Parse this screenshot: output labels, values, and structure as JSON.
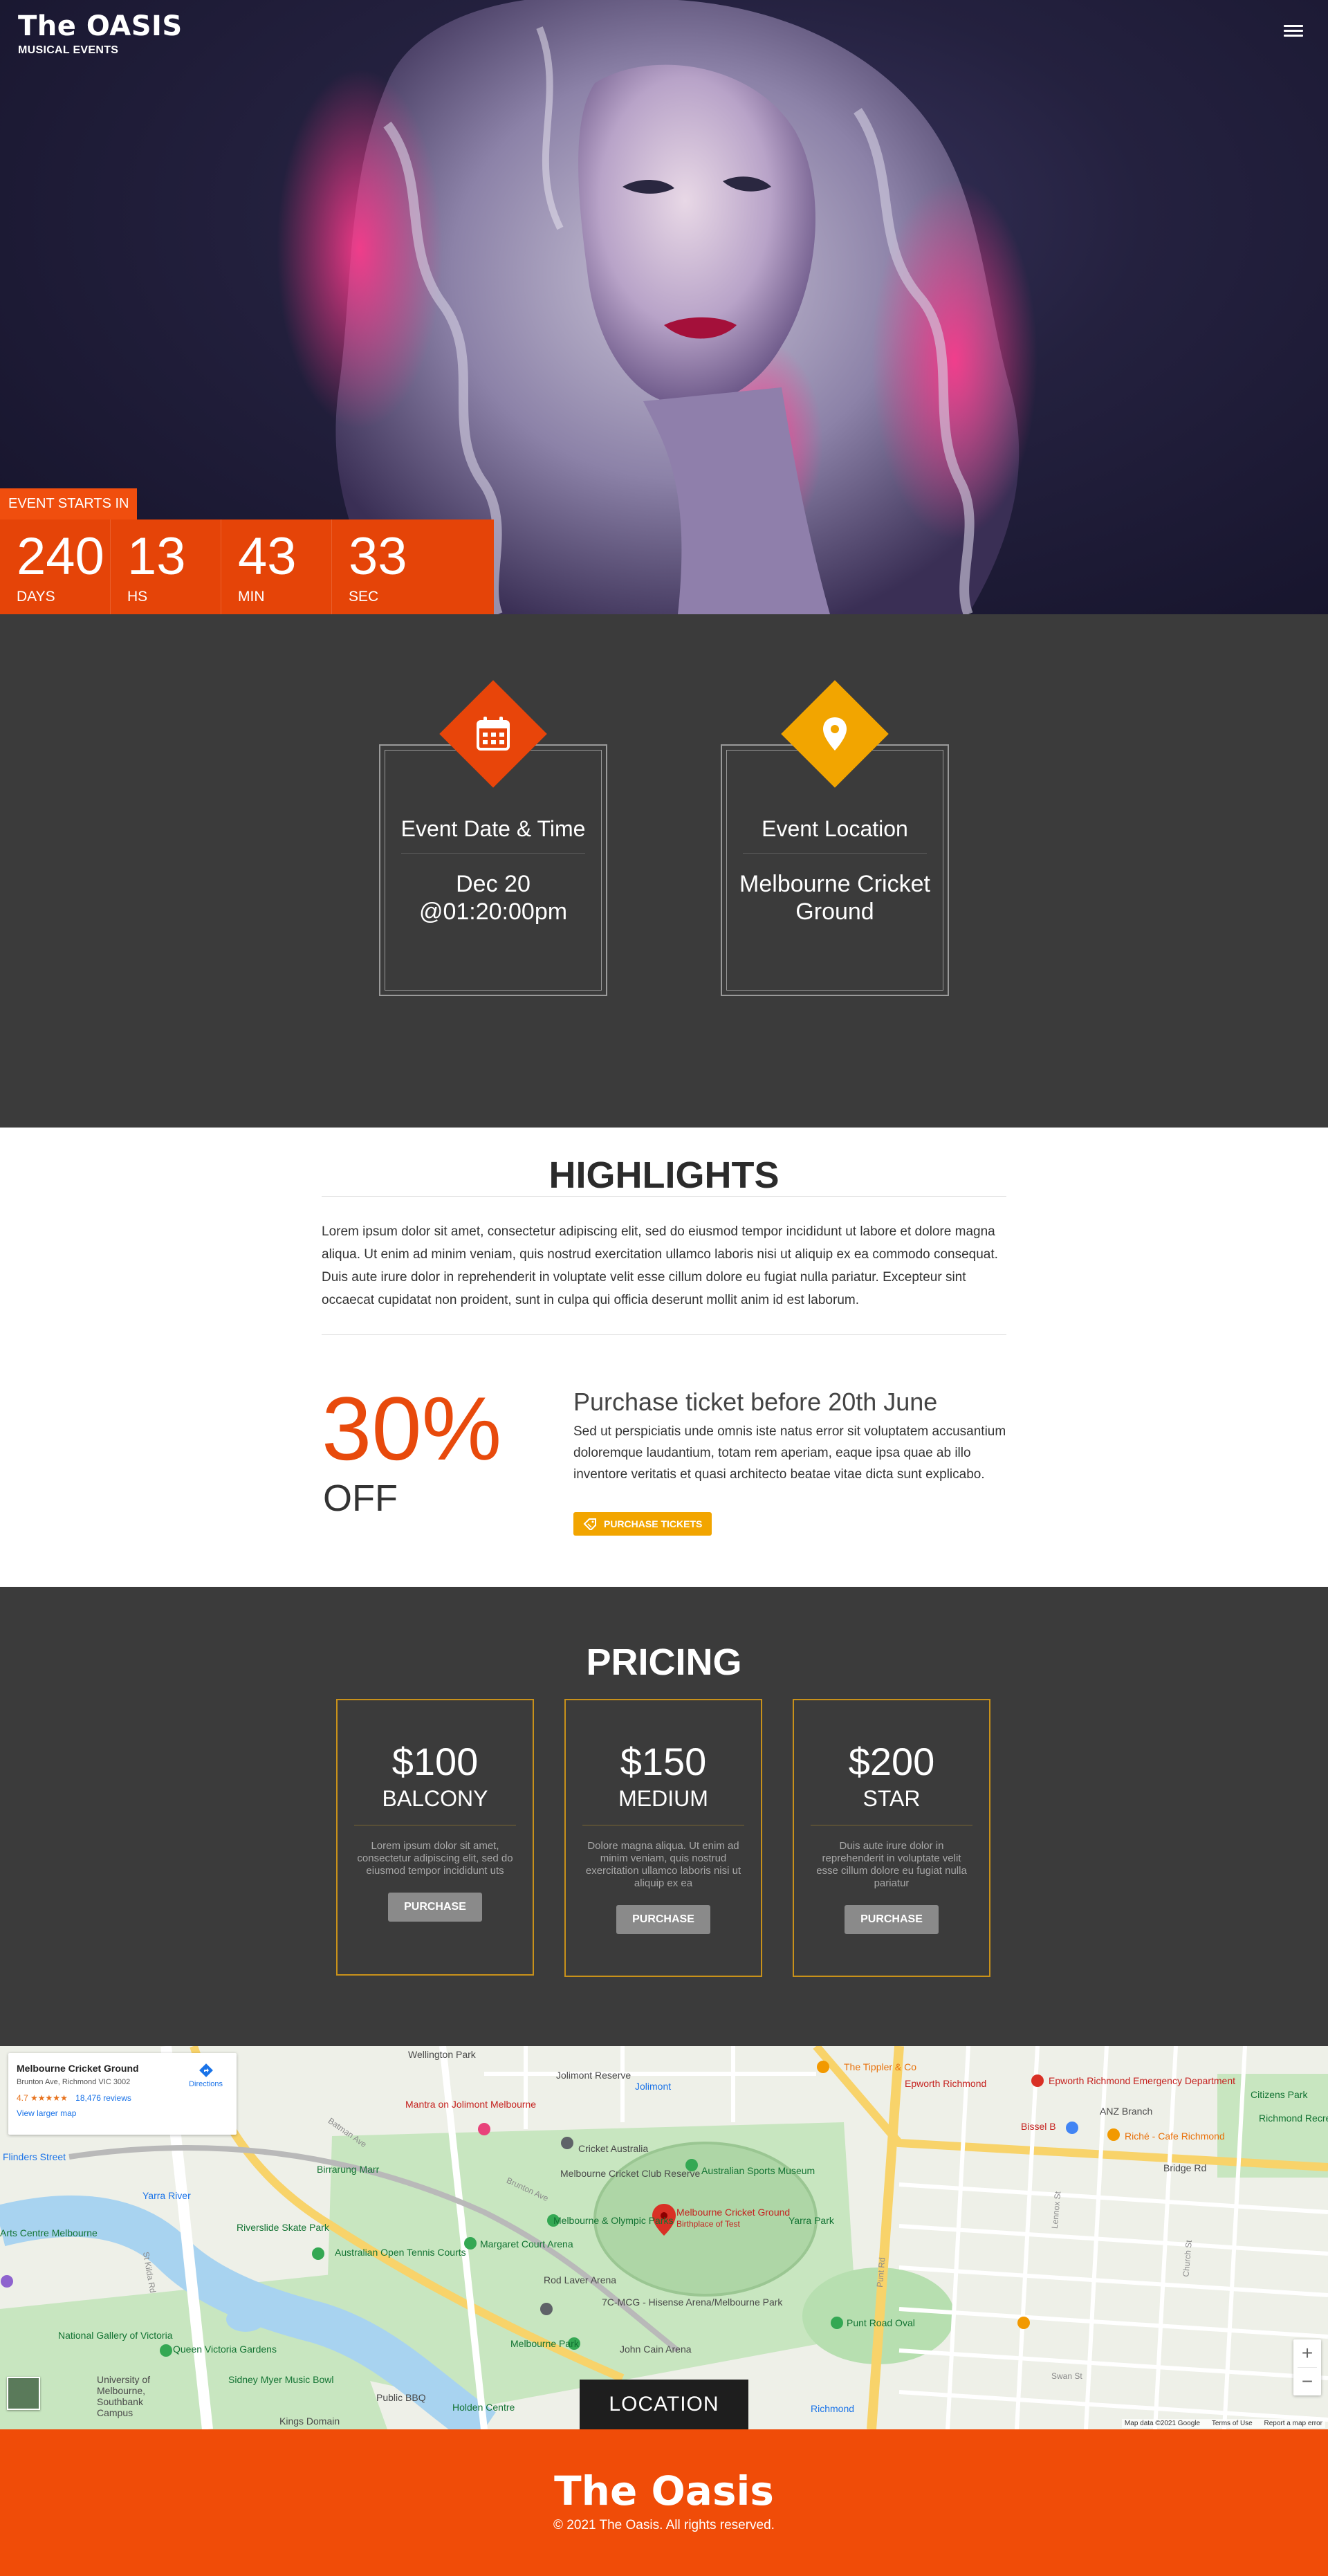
{
  "header": {
    "brand": "The OASIS",
    "tagline": "MUSICAL EVENTS",
    "menu_icon": "hamburger-icon"
  },
  "countdown": {
    "label": "EVENT STARTS IN",
    "cells": [
      {
        "value": "240",
        "unit": "DAYS"
      },
      {
        "value": "13",
        "unit": "HS"
      },
      {
        "value": "43",
        "unit": "MIN"
      },
      {
        "value": "33",
        "unit": "SEC"
      }
    ]
  },
  "info": {
    "date": {
      "title": "Event Date & Time",
      "value_line1": "Dec 20",
      "value_line2": "@01:20:00pm",
      "icon": "calendar-icon",
      "color": "#e8450a"
    },
    "location": {
      "title": "Event Location",
      "value_line1": "Melbourne Cricket",
      "value_line2": "Ground",
      "icon": "map-pin-icon",
      "color": "#f2a500"
    }
  },
  "highlights": {
    "title": "HIGHLIGHTS",
    "text": "Lorem ipsum dolor sit amet, consectetur adipiscing elit, sed do eiusmod tempor incididunt ut labore et dolore magna aliqua. Ut enim ad minim veniam, quis nostrud exercitation ullamco laboris nisi ut aliquip ex ea commodo consequat. Duis aute irure dolor in reprehenderit in voluptate velit esse cillum dolore eu fugiat nulla pariatur. Excepteur sint occaecat cupidatat non proident, sunt in culpa qui officia deserunt mollit anim id est laborum.",
    "promo": {
      "percent": "30%",
      "off": "OFF",
      "heading": "Purchase ticket before 20th June",
      "text": "Sed ut perspiciatis unde omnis iste natus error sit voluptatem accusantium doloremque laudantium, totam rem aperiam, eaque ipsa quae ab illo inventore veritatis et quasi architecto beatae vitae dicta sunt explicabo.",
      "button": "PURCHASE TICKETS"
    }
  },
  "pricing": {
    "title": "PRICING",
    "plans": [
      {
        "price": "$100",
        "name": "BALCONY",
        "desc": "Lorem ipsum dolor sit amet, consectetur adipiscing elit, sed do eiusmod tempor incididunt uts",
        "button": "PURCHASE"
      },
      {
        "price": "$150",
        "name": "MEDIUM",
        "desc": "Dolore magna aliqua. Ut enim ad minim veniam, quis nostrud exercitation ullamco laboris nisi ut aliquip ex ea",
        "button": "PURCHASE"
      },
      {
        "price": "$200",
        "name": "STAR",
        "desc": "Duis aute irure dolor in reprehenderit in voluptate velit esse cillum dolore eu fugiat nulla pariatur",
        "button": "PURCHASE"
      }
    ]
  },
  "map": {
    "place_name": "Melbourne Cricket Ground",
    "address": "Brunton Ave, Richmond VIC 3002",
    "rating": "4.7",
    "stars": "★★★★★",
    "reviews": "18,476 reviews",
    "view_larger": "View larger map",
    "directions": "Directions",
    "location_button": "LOCATION",
    "zoom_in": "+",
    "zoom_out": "−",
    "attribution": {
      "data": "Map data ©2021 Google",
      "terms": "Terms of Use",
      "report": "Report a map error"
    },
    "labels": {
      "wellington_park": "Wellington Park",
      "jolimont_reserve": "Jolimont Reserve",
      "jolimont": "Jolimont",
      "tippler": "The Tippler & Co",
      "epworth": "Epworth Richmond",
      "epworth_ed": "Epworth Richmond Emergency Department",
      "citizens_park": "Citizens Park",
      "richmond_rec": "Richmond Recreation Centre",
      "anz": "ANZ Branch",
      "bissel": "Bissel B",
      "riche": "Riché - Cafe Richmond",
      "bridge_rd": "Bridge Rd",
      "mantra": "Mantra on Jolimont Melbourne",
      "flinders": "Flinders Street",
      "cricket_australia": "Cricket Australia",
      "mcc_reserve": "Melbourne Cricket Club Reserve",
      "sports_museum": "Australian Sports Museum",
      "mcg": "Melbourne Cricket Ground",
      "mcg_sub": "Birthplace of Test",
      "yarra_park": "Yarra Park",
      "birrarung": "Birrarung Marr",
      "yarra_river": "Yarra River",
      "arts_centre": "Arts Centre Melbourne",
      "riverslide": "Riverslide Skate Park",
      "ao_tennis": "Australian Open Tennis Courts",
      "margaret_court": "Margaret Court Arena",
      "rod_laver": "Rod Laver Arena",
      "melb_olympic": "Melbourne & Olympic Parks",
      "mcg_hisense": "7C-MCG - Hisense Arena/Melbourne Park",
      "punt_road": "Punt Road Oval",
      "melbourne_park": "Melbourne Park",
      "john_cain": "John Cain Arena",
      "ngv": "National Gallery of Victoria",
      "queen_victoria": "Queen Victoria Gardens",
      "sidney_myer": "Sidney Myer Music Bowl",
      "uni_southbank": "University of Melbourne, Southbank Campus",
      "kings_domain": "Kings Domain",
      "public_bbq": "Public BBQ",
      "holden_centre": "Holden Centre",
      "richmond": "Richmond",
      "batman_ave": "Batman Ave",
      "brunton_ave": "Brunton Ave",
      "st_kilda_rd": "St Kilda Rd",
      "punt_rd": "Punt Rd",
      "church_st": "Church St",
      "lennox_st": "Lennox St",
      "swan_st": "Swan St"
    }
  },
  "footer": {
    "brand": "The Oasis",
    "copyright": "© 2021 The Oasis. All rights reserved."
  },
  "colors": {
    "accent_orange": "#e8450a",
    "accent_gold": "#f2a500",
    "dark_section": "#3b3b3b"
  }
}
